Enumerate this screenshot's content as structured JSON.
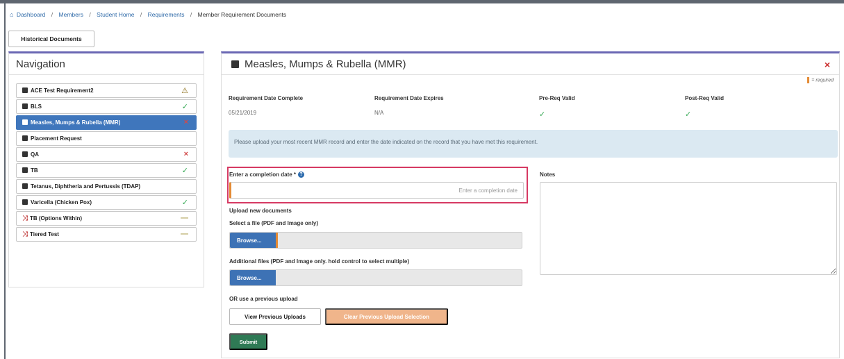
{
  "breadcrumb": {
    "items": [
      "Dashboard",
      "Members",
      "Student Home",
      "Requirements"
    ],
    "current": "Member Requirement Documents"
  },
  "historical_button": "Historical Documents",
  "navigation": {
    "title": "Navigation",
    "items": [
      {
        "label": "ACE Test Requirement2",
        "status": "⚠",
        "marker": "square"
      },
      {
        "label": "BLS",
        "status": "✓",
        "marker": "square"
      },
      {
        "label": "Measles, Mumps & Rubella (MMR)",
        "status": "×",
        "marker": "square",
        "active": true
      },
      {
        "label": "Placement Request",
        "status": "",
        "marker": "square"
      },
      {
        "label": "QA",
        "status": "×",
        "marker": "square"
      },
      {
        "label": "TB",
        "status": "✓",
        "marker": "square"
      },
      {
        "label": "Tetanus, Diphtheria and Pertussis (TDAP)",
        "status": "",
        "marker": "square"
      },
      {
        "label": "Varicella (Chicken Pox)",
        "status": "✓",
        "marker": "square"
      },
      {
        "label": "TB (Options Within)",
        "status": "—",
        "marker": "x"
      },
      {
        "label": "Tiered Test",
        "status": "—",
        "marker": "x"
      }
    ]
  },
  "requirement": {
    "title": "Measles, Mumps & Rubella (MMR)",
    "close_icon": "×",
    "required_note": "= required",
    "date_complete_label": "Requirement Date Complete",
    "date_complete_value": "05/21/2019",
    "date_expires_label": "Requirement Date Expires",
    "date_expires_value": "N/A",
    "prereq_label": "Pre-Req Valid",
    "prereq_value": "✓",
    "postreq_label": "Post-Req Valid",
    "postreq_value": "✓",
    "alert": "Please upload your most recent MMR record and enter the date indicated on the record that you have met this requirement.",
    "completion_label": "Enter a completion date *",
    "completion_placeholder": "Enter a completion date",
    "notes_label": "Notes",
    "upload_new_label": "Upload new documents",
    "select_file_label": "Select a file (PDF and Image only)",
    "browse_label": "Browse...",
    "additional_label": "Additional files (PDF and Image only. hold control to select multiple)",
    "previous_label": "OR use a previous upload",
    "view_previous_button": "View Previous Uploads",
    "clear_previous_button": "Clear Previous Upload Selection",
    "submit_button": "Submit"
  }
}
